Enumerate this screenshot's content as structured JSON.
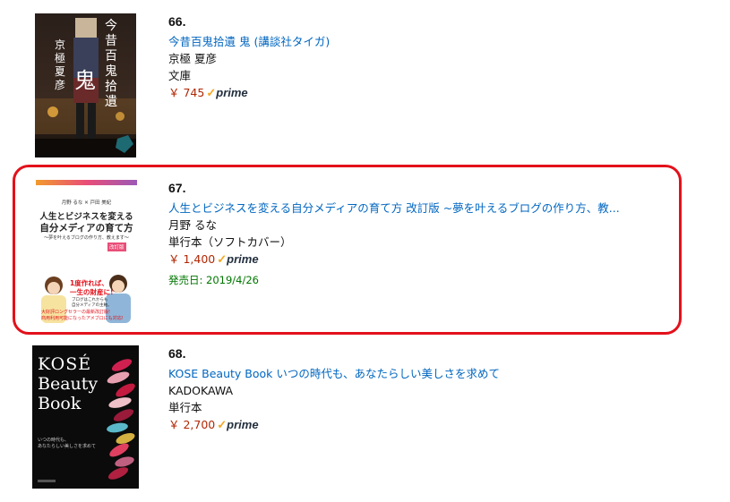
{
  "items": [
    {
      "rank": "66.",
      "title": "今昔百鬼拾遺 鬼 (講談社タイガ)",
      "author": "京極 夏彦",
      "format": "文庫",
      "price": "￥ 745",
      "prime": "prime",
      "cover": {
        "author": "京極夏彦",
        "title": "今昔百鬼拾遺",
        "big": "鬼"
      }
    },
    {
      "rank": "67.",
      "title": "人生とビジネスを変える自分メディアの育て方 改訂版 ~夢を叶えるブログの作り方、教...",
      "author": "月野 るな",
      "format": "単行本（ソフトカバー）",
      "price": "￥ 1,400",
      "prime": "prime",
      "release": "発売日: 2019/4/26",
      "cover": {
        "authors": "月野 るな ✕ 戸田 美紀",
        "title1": "人生とビジネスを変える",
        "title2": "自分メディアの育て方",
        "subtitle": "～夢を叶えるブログの作り方、教えます～",
        "edition": "改訂版",
        "catch1": "1度作れば、",
        "catch2": "一生の財産に!",
        "catch3": "ブログはこれからも",
        "catch4": "自分メディアの主軸。",
        "note1": "大好評ロングセラーの最新改訂版!",
        "note2": "商用利用可能になったアメブロにも対応!"
      }
    },
    {
      "rank": "68.",
      "title": "KOSE Beauty Book いつの時代も、あなたらしい美しさを求めて",
      "author": "KADOKAWA",
      "format": "単行本",
      "price": "￥ 2,700",
      "prime": "prime",
      "cover": {
        "brand": "KOSÉ",
        "line1": "Beauty",
        "line2": "Book",
        "tag1": "いつの時代も、",
        "tag2": "あなたらしい美しさを求めて"
      }
    }
  ]
}
